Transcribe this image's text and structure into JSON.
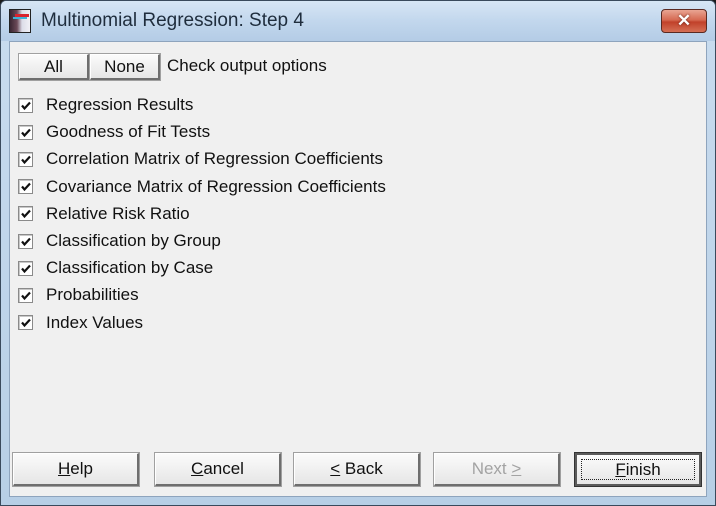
{
  "window": {
    "title": "Multinomial Regression: Step 4",
    "icon": "app-icon",
    "close_icon": "close-icon",
    "close_glyph": "✕"
  },
  "toolbar": {
    "all_label": "All",
    "none_label": "None",
    "instruction": "Check output options"
  },
  "options": [
    {
      "label": "Regression Results",
      "checked": true
    },
    {
      "label": "Goodness of Fit Tests",
      "checked": true
    },
    {
      "label": "Correlation Matrix of Regression Coefficients",
      "checked": true
    },
    {
      "label": "Covariance Matrix of Regression Coefficients",
      "checked": true
    },
    {
      "label": "Relative Risk Ratio",
      "checked": true
    },
    {
      "label": "Classification by Group",
      "checked": true
    },
    {
      "label": "Classification by Case",
      "checked": true
    },
    {
      "label": "Probabilities",
      "checked": true
    },
    {
      "label": "Index Values",
      "checked": true
    }
  ],
  "footer": {
    "help": {
      "accel": "H",
      "rest": "elp"
    },
    "cancel": {
      "accel": "C",
      "rest": "ancel"
    },
    "back": {
      "accel": "<",
      "rest": " Back"
    },
    "next": {
      "pre": "Next ",
      "accel": ">",
      "disabled": true
    },
    "finish": {
      "accel": "F",
      "rest": "inish",
      "default": true
    }
  }
}
